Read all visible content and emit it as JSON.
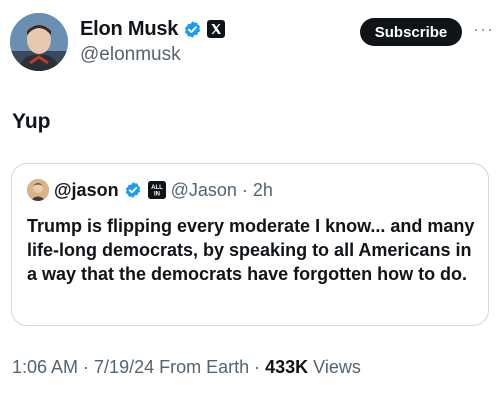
{
  "author": {
    "name": "Elon Musk",
    "handle": "@elonmusk",
    "verified_icon": "verified-badge-icon",
    "affiliation_icon": "x-logo-icon"
  },
  "actions": {
    "subscribe_label": "Subscribe",
    "more_label": "···"
  },
  "tweet": {
    "text": "Yup"
  },
  "quote": {
    "name": "@jason",
    "handle": "@Jason",
    "separator": "·",
    "time": "2h",
    "affiliation_badge": "ALL IN",
    "text": "Trump is flipping every moderate I know... and many life-long democrats, by speaking to all Americans in a way that the democrats have forgotten how to do."
  },
  "meta": {
    "time": "1:06 AM",
    "sep1": "·",
    "date": "7/19/24",
    "source": "From Earth",
    "sep2": "·",
    "views_count": "433K",
    "views_label": "Views"
  },
  "colors": {
    "text": "#0f1419",
    "secondary": "#536471",
    "verified_blue": "#1d9bf0",
    "border": "#cfd9de"
  }
}
